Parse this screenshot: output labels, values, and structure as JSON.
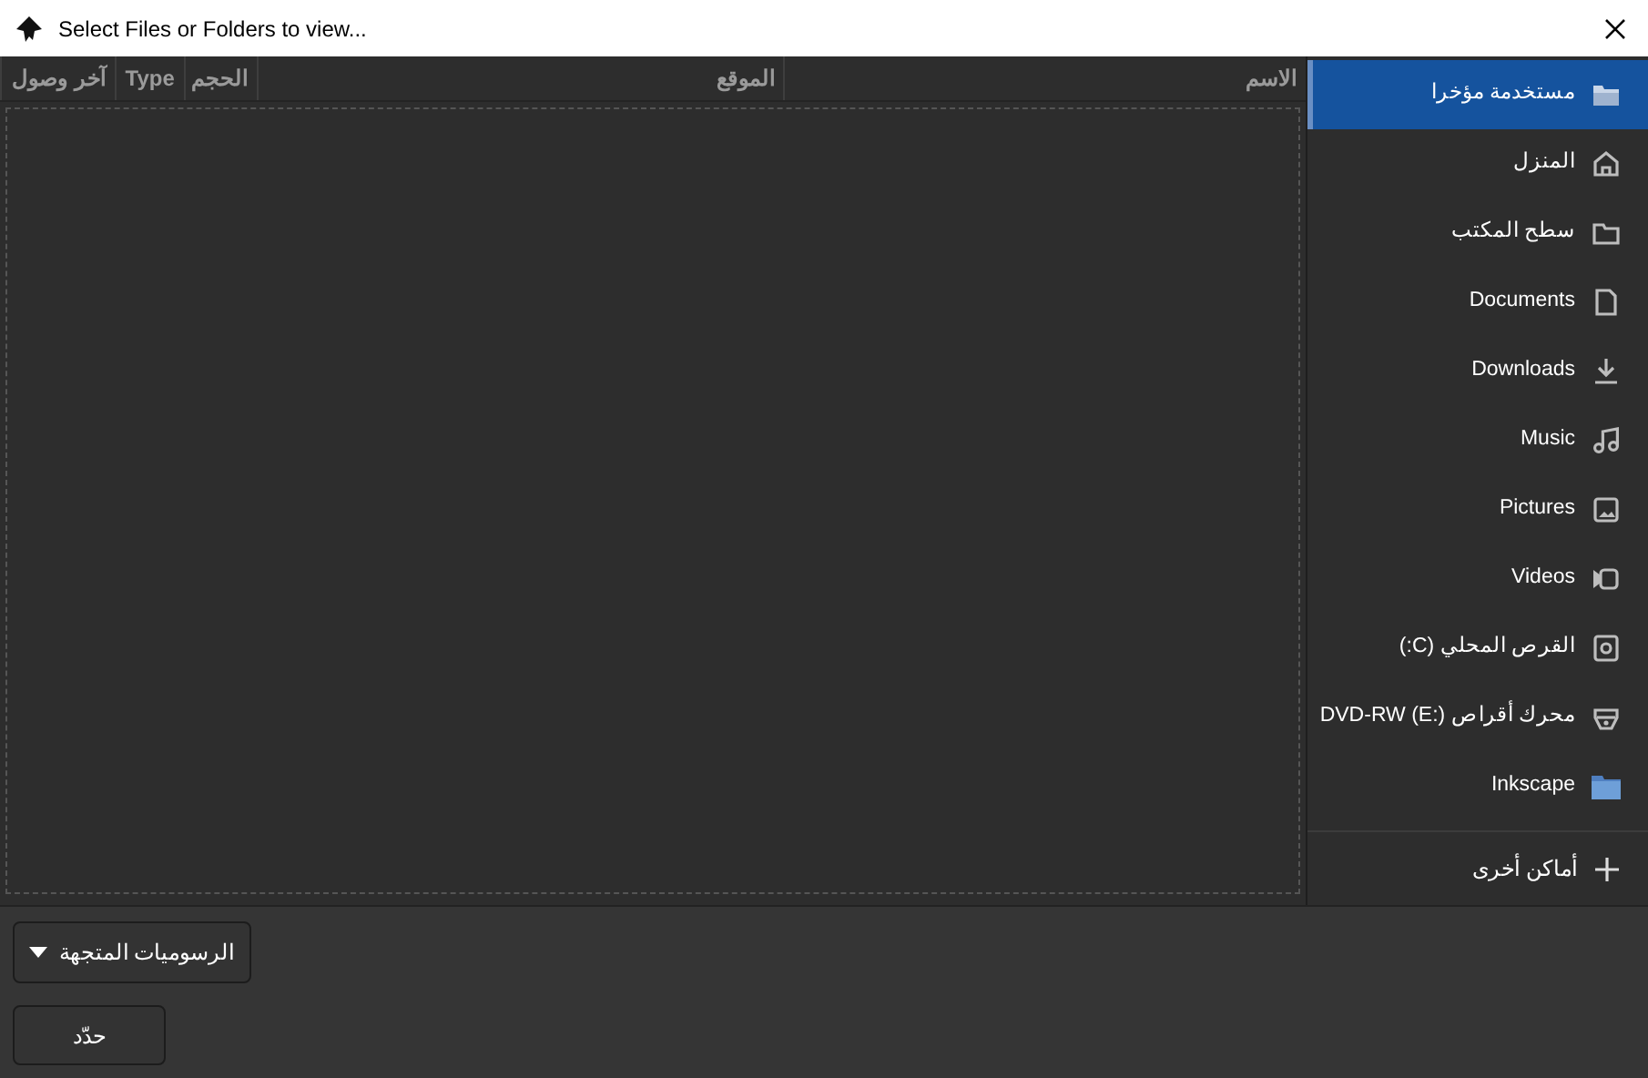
{
  "window": {
    "title": "Select Files or Folders to view..."
  },
  "table": {
    "columns": [
      {
        "label": "الاسم"
      },
      {
        "label": "الموقع"
      },
      {
        "label": "الحجم"
      },
      {
        "label": "Type"
      },
      {
        "label": "آخر وصول"
      }
    ]
  },
  "sidebar": {
    "items": [
      {
        "label": "مستخدمة مؤخرا",
        "kind": "recent",
        "selected": true
      },
      {
        "label": "المنزل",
        "kind": "home",
        "selected": false
      },
      {
        "label": "سطح المكتب",
        "kind": "folder",
        "selected": false
      },
      {
        "label": "Documents",
        "kind": "document",
        "selected": false
      },
      {
        "label": "Downloads",
        "kind": "download",
        "selected": false
      },
      {
        "label": "Music",
        "kind": "music",
        "selected": false
      },
      {
        "label": "Pictures",
        "kind": "image",
        "selected": false
      },
      {
        "label": "Videos",
        "kind": "video",
        "selected": false
      },
      {
        "label": "القرص المحلي (C:)",
        "kind": "disk",
        "selected": false
      },
      {
        "label": "محرك أقراص DVD-RW (E:)",
        "kind": "optical",
        "selected": false
      },
      {
        "label": "Inkscape",
        "kind": "bookmark",
        "selected": false
      }
    ],
    "other_locations": {
      "label": "أماكن أخرى"
    }
  },
  "filter_button": {
    "label": "الرسوميات المتجهة"
  },
  "select_button": {
    "label": "حدّد"
  }
}
